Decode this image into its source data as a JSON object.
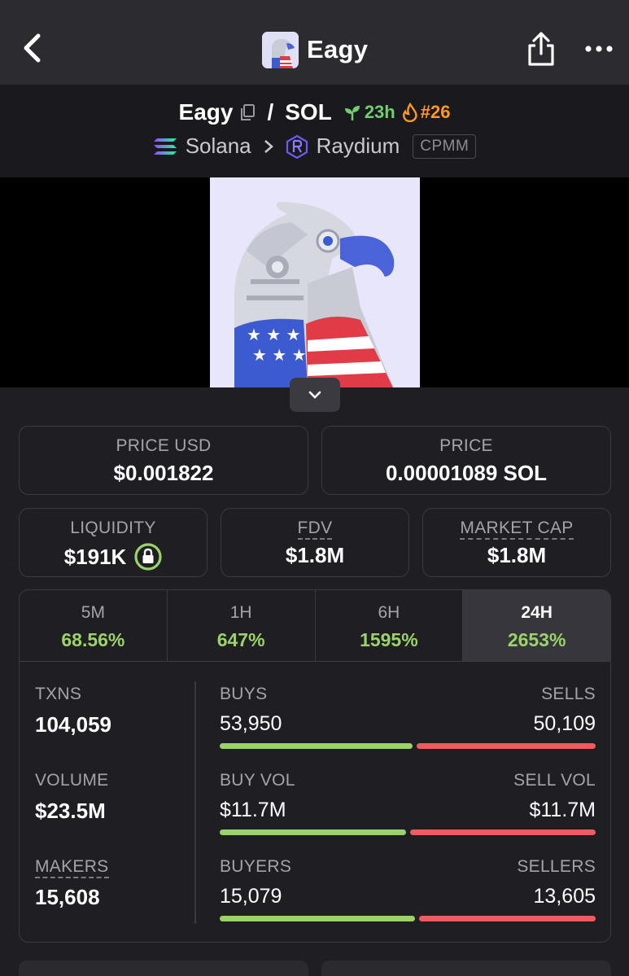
{
  "topbar": {
    "title": "Eagy"
  },
  "pair": {
    "base": "Eagy",
    "quote": "SOL",
    "slash": "/",
    "age": "23h",
    "rank": "#26",
    "chain": "Solana",
    "dex": "Raydium",
    "pool_type": "CPMM"
  },
  "price": {
    "usd_label": "PRICE USD",
    "usd_value": "$0.001822",
    "native_label": "PRICE",
    "native_value": "0.00001089 SOL"
  },
  "metrics": {
    "liquidity_label": "LIQUIDITY",
    "liquidity_value": "$191K",
    "fdv_label": "FDV",
    "fdv_value": "$1.8M",
    "mcap_label": "MARKET CAP",
    "mcap_value": "$1.8M"
  },
  "tabs": [
    {
      "label": "5M",
      "change": "68.56%"
    },
    {
      "label": "1H",
      "change": "647%"
    },
    {
      "label": "6H",
      "change": "1595%"
    },
    {
      "label": "24H",
      "change": "2653%",
      "active": true
    }
  ],
  "stats": {
    "txns_label": "TXNS",
    "txns_value": "104,059",
    "volume_label": "VOLUME",
    "volume_value": "$23.5M",
    "makers_label": "MAKERS",
    "makers_value": "15,608",
    "buys_label": "BUYS",
    "buys_value": "53,950",
    "sells_label": "SELLS",
    "sells_value": "50,109",
    "buy_vol_label": "BUY VOL",
    "buy_vol_value": "$11.7M",
    "sell_vol_label": "SELL VOL",
    "sell_vol_value": "$11.7M",
    "buyers_label": "BUYERS",
    "buyers_value": "15,079",
    "sellers_label": "SELLERS",
    "sellers_value": "13,605",
    "buys_ratio": 0.518,
    "vol_ratio": 0.5,
    "buyers_ratio": 0.526
  },
  "colors": {
    "green": "#9bd26a",
    "red": "#ef5b5e",
    "orange": "#ff9a1f"
  },
  "icons": [
    "back-chevron-icon",
    "share-icon",
    "more-dots-icon",
    "copy-icon",
    "sprout-icon",
    "flame-icon",
    "solana-icon",
    "raydium-icon",
    "chevron-down-icon",
    "lock-icon"
  ]
}
